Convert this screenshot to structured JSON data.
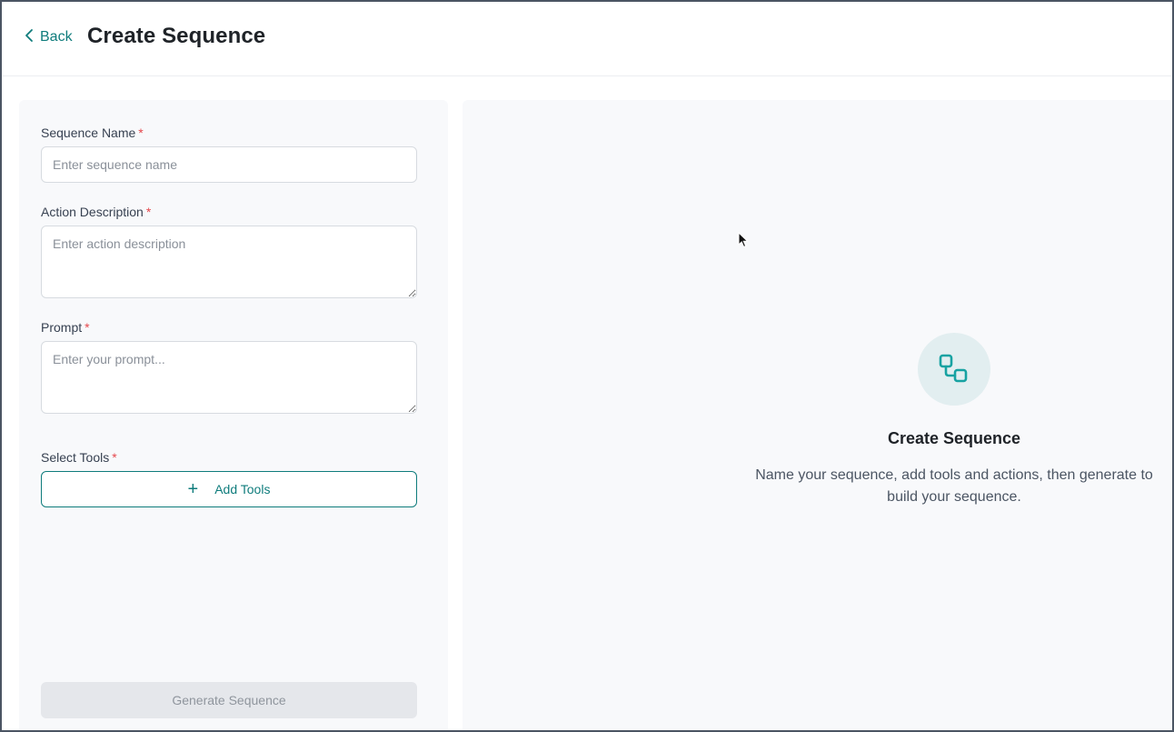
{
  "header": {
    "back_label": "Back",
    "title": "Create Sequence"
  },
  "form": {
    "sequence_name": {
      "label": "Sequence Name",
      "required_mark": "*",
      "value": "",
      "placeholder": "Enter sequence name"
    },
    "action_description": {
      "label": "Action Description",
      "required_mark": "*",
      "value": "",
      "placeholder": "Enter action description"
    },
    "prompt": {
      "label": "Prompt",
      "required_mark": "*",
      "value": "",
      "placeholder": "Enter your prompt..."
    },
    "tools": {
      "label": "Select Tools",
      "required_mark": "*",
      "add_label": "Add Tools",
      "add_icon": "plus-icon"
    },
    "generate_label": "Generate Sequence"
  },
  "empty_state": {
    "icon": "sequence-icon",
    "title": "Create Sequence",
    "description": "Name your sequence, add tools and actions, then generate to build your sequence."
  },
  "colors": {
    "accent": "#0f7c7c",
    "required": "#e5484d",
    "panel_bg": "#f8f9fb",
    "icon_circle": "#e2eef0"
  }
}
